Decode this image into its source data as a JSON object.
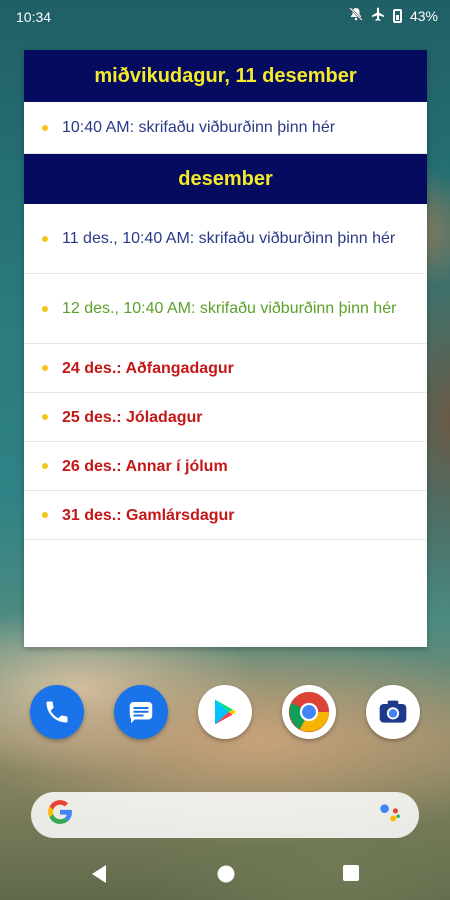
{
  "status_bar": {
    "time": "10:34",
    "battery": "43%",
    "icons": [
      "notifications-off-icon",
      "airplane-mode-icon",
      "battery-icon"
    ]
  },
  "widget": {
    "header_title": "miðvikudagur, 11 desember",
    "today_events": [
      {
        "text": "10:40 AM: skrifaðu viðburðinn þinn hér",
        "color": "#2b3a87"
      }
    ],
    "month_title": "desember",
    "month_events": [
      {
        "text": "11 des., 10:40 AM: skrifaðu viðburðinn þinn hér",
        "color": "#2b3a87"
      },
      {
        "text": "12 des., 10:40 AM: skrifaðu viðburðinn þinn hér",
        "color": "#5aa12a"
      },
      {
        "text": "24 des.: Aðfangadagur",
        "color": "#c41717"
      },
      {
        "text": "25 des.: Jóladagur",
        "color": "#c41717"
      },
      {
        "text": "26 des.: Annar í jólum",
        "color": "#c41717"
      },
      {
        "text": "31 des.: Gamlársdagur",
        "color": "#c41717"
      }
    ],
    "colors": {
      "header_bg": "#050c5f",
      "header_text": "#f4ea2a",
      "bullet": "#f3c51c"
    }
  },
  "dock": {
    "apps": [
      "phone-icon",
      "messages-icon",
      "play-store-icon",
      "chrome-icon",
      "camera-icon"
    ]
  },
  "search_bar": {
    "logo": "google-g-icon",
    "assistant": "assistant-icon"
  },
  "nav_bar": {
    "buttons": [
      "back-icon",
      "home-icon",
      "recents-icon"
    ]
  }
}
